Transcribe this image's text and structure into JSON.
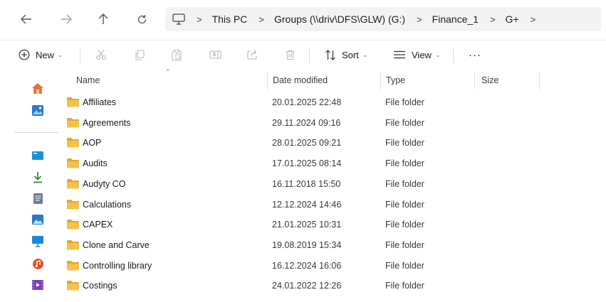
{
  "address_bar": {
    "crumbs": [
      "This PC",
      "Groups (\\\\driv\\DFS\\GLW) (G:)",
      "Finance_1",
      "G+"
    ],
    "end_chevron": ">"
  },
  "command_bar": {
    "new_label": "New",
    "sort_label": "Sort",
    "view_label": "View",
    "more_label": "···"
  },
  "columns": {
    "name": "Name",
    "date_modified": "Date modified",
    "type": "Type",
    "size": "Size"
  },
  "files": [
    {
      "name": "Affiliates",
      "date": "20.01.2025 22:48",
      "type": "File folder",
      "size": ""
    },
    {
      "name": "Agreements",
      "date": "29.11.2024 09:16",
      "type": "File folder",
      "size": ""
    },
    {
      "name": "AOP",
      "date": "28.01.2025 09:21",
      "type": "File folder",
      "size": ""
    },
    {
      "name": "Audits",
      "date": "17.01.2025 08:14",
      "type": "File folder",
      "size": ""
    },
    {
      "name": "Audyty CO",
      "date": "16.11.2018 15:50",
      "type": "File folder",
      "size": ""
    },
    {
      "name": "Calculations",
      "date": "12.12.2024 14:46",
      "type": "File folder",
      "size": ""
    },
    {
      "name": "CAPEX",
      "date": "21.01.2025 10:31",
      "type": "File folder",
      "size": ""
    },
    {
      "name": "Clone and Carve",
      "date": "19.08.2019 15:34",
      "type": "File folder",
      "size": ""
    },
    {
      "name": "Controlling library",
      "date": "16.12.2024 16:06",
      "type": "File folder",
      "size": ""
    },
    {
      "name": "Costings",
      "date": "24.01.2022 12:26",
      "type": "File folder",
      "size": ""
    }
  ],
  "icons": {
    "back": "arrow-left-icon",
    "forward": "arrow-right-icon",
    "up": "arrow-up-icon",
    "refresh": "refresh-icon",
    "pc": "monitor-icon",
    "folder": "folder-icon"
  },
  "colors": {
    "folder": "#f2c14e",
    "folder_dark": "#e0a929",
    "home": "#e2733a",
    "gallery": "#2e79c7",
    "desktop": "#1a90d9",
    "downloads": "#2b8a3e",
    "music": "#e0562e",
    "videos": "#7b3fb8"
  }
}
